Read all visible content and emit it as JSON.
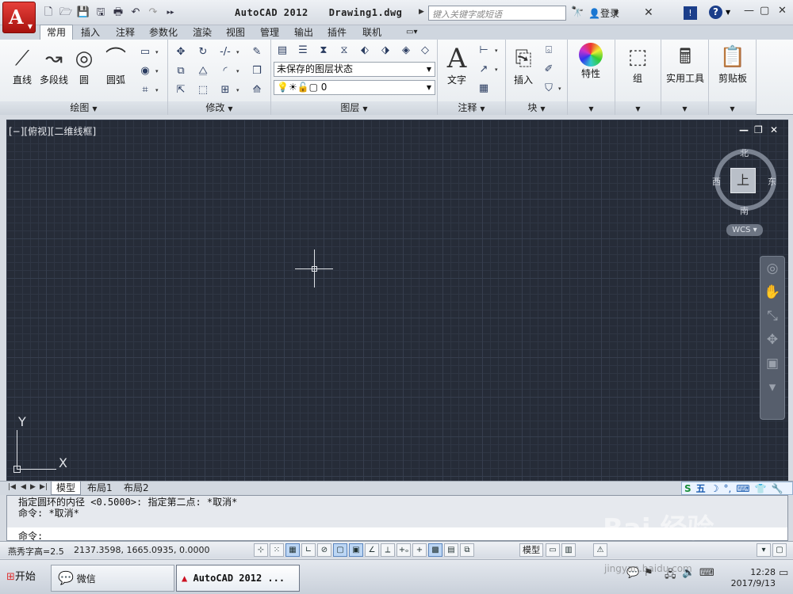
{
  "titlebar": {
    "app": "AutoCAD 2012",
    "file": "Drawing1.dwg",
    "search_placeholder": "键入关键字或短语",
    "login": "登录"
  },
  "ribbon": {
    "tabs": [
      "常用",
      "插入",
      "注释",
      "参数化",
      "渲染",
      "视图",
      "管理",
      "输出",
      "插件",
      "联机"
    ],
    "draw": {
      "line": "直线",
      "polyline": "多段线",
      "circle": "圆",
      "arc": "圆弧",
      "title": "绘图"
    },
    "modify": {
      "title": "修改"
    },
    "layers": {
      "state": "未保存的图层状态",
      "current": "0",
      "title": "图层"
    },
    "annotation": {
      "text": "文字",
      "title": "注释"
    },
    "block": {
      "insert": "插入",
      "title": "块"
    },
    "properties": "特性",
    "group": "组",
    "utilities": "实用工具",
    "clipboard": "剪贴板"
  },
  "viewport": {
    "label": "[−][俯视][二维线框]",
    "compass": {
      "north": "北",
      "south": "南",
      "east": "东",
      "west": "西",
      "face": "上"
    },
    "wcs": "WCS",
    "ucs": {
      "x": "X",
      "y": "Y"
    }
  },
  "layout_tabs": [
    "模型",
    "布局1",
    "布局2"
  ],
  "ime": {
    "label": "五"
  },
  "command": {
    "history": [
      "指定圆环的内径 <0.5000>:  指定第二点: *取消*",
      "命令: *取消*"
    ],
    "prompt": "命令:"
  },
  "status": {
    "annot_scale": "燕秀字高=2.5",
    "coords": "2137.3598, 1665.0935, 0.0000",
    "model": "模型"
  },
  "taskbar": {
    "start": "开始",
    "wechat": "微信",
    "autocad": "AutoCAD 2012 ...",
    "time": "12:28",
    "date": "2017/9/13"
  },
  "watermark": {
    "text": "Bai 经验",
    "sub": "jingyan.baidu.com"
  }
}
